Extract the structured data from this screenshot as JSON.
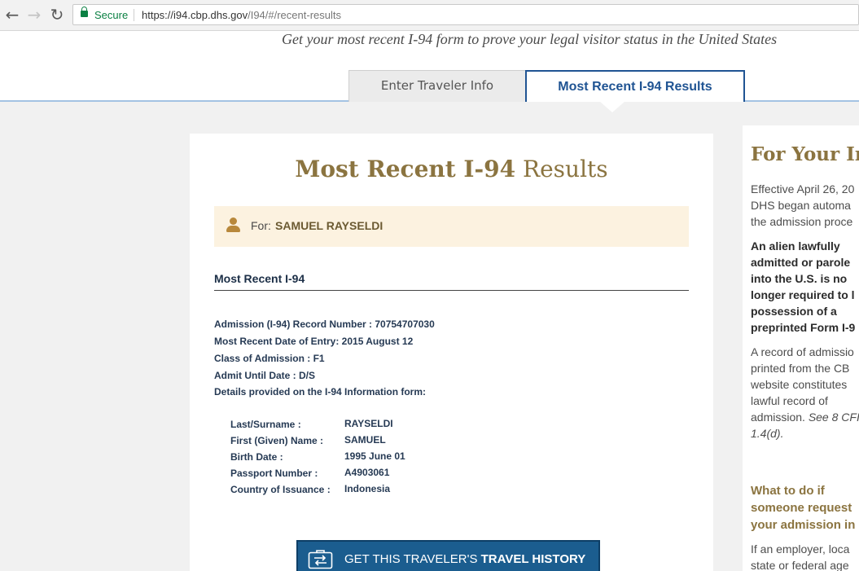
{
  "browser": {
    "back_icon": "back-arrow-icon",
    "forward_icon": "forward-arrow-icon",
    "reload_icon": "reload-icon",
    "lock_icon": "lock-icon",
    "secure_label": "Secure",
    "url_host": "https://i94.cbp.dhs.gov",
    "url_path": "/I94/#/recent-results"
  },
  "header": {
    "tagline": "Get your most recent I-94 form to prove your legal visitor status in the United States",
    "tabs": [
      {
        "label": "Enter Traveler Info",
        "active": false
      },
      {
        "label": "Most Recent I-94 Results",
        "active": true
      }
    ]
  },
  "results": {
    "title_bold": "Most Recent I-94",
    "title_rest": " Results",
    "for_label": "For:",
    "traveler_name": "SAMUEL RAYSELDI",
    "section_title": "Most Recent I-94",
    "details": [
      "Admission (I-94) Record Number : 70754707030",
      "Most Recent Date of Entry: 2015 August 12",
      "Class of Admission : F1",
      "Admit Until Date : D/S",
      "Details provided on the I-94 Information form:"
    ],
    "info_form": [
      {
        "label": "Last/Surname :",
        "value": "RAYSELDI"
      },
      {
        "label": "First (Given) Name :",
        "value": "SAMUEL"
      },
      {
        "label": "Birth Date :",
        "value": "1995 June 01"
      },
      {
        "label": "Passport Number :",
        "value": "A4903061"
      },
      {
        "label": "Country of Issuance :",
        "value": "Indonesia"
      }
    ],
    "history_button": {
      "prefix": "GET THIS TRAVELER'S ",
      "emphasis": "TRAVEL HISTORY",
      "icon": "travel-history-icon"
    }
  },
  "sidebar": {
    "title": "For Your Inf",
    "para1": [
      "Effective April 26, 20",
      "DHS began automa",
      "the admission proce"
    ],
    "para2": [
      "An alien lawfully",
      "admitted or parole",
      "into the U.S. is no",
      "longer required to l",
      "possession of a",
      "preprinted Form I-9"
    ],
    "para3": [
      "A record of admissio",
      "printed from the CB",
      "website constitutes",
      "lawful record of"
    ],
    "para3_last": "admission. ",
    "para3_cite": "See 8 CFI",
    "para3_cite2": "1.4(d).",
    "para4": [
      "What to do if",
      "someone request",
      "your admission in"
    ],
    "para5": [
      "If an employer, loca",
      "state or federal age"
    ]
  },
  "colors": {
    "accent_blue": "#205493",
    "gold": "#8b7440",
    "name_bar": "#fcf2e0",
    "button": "#1b5d8f"
  }
}
